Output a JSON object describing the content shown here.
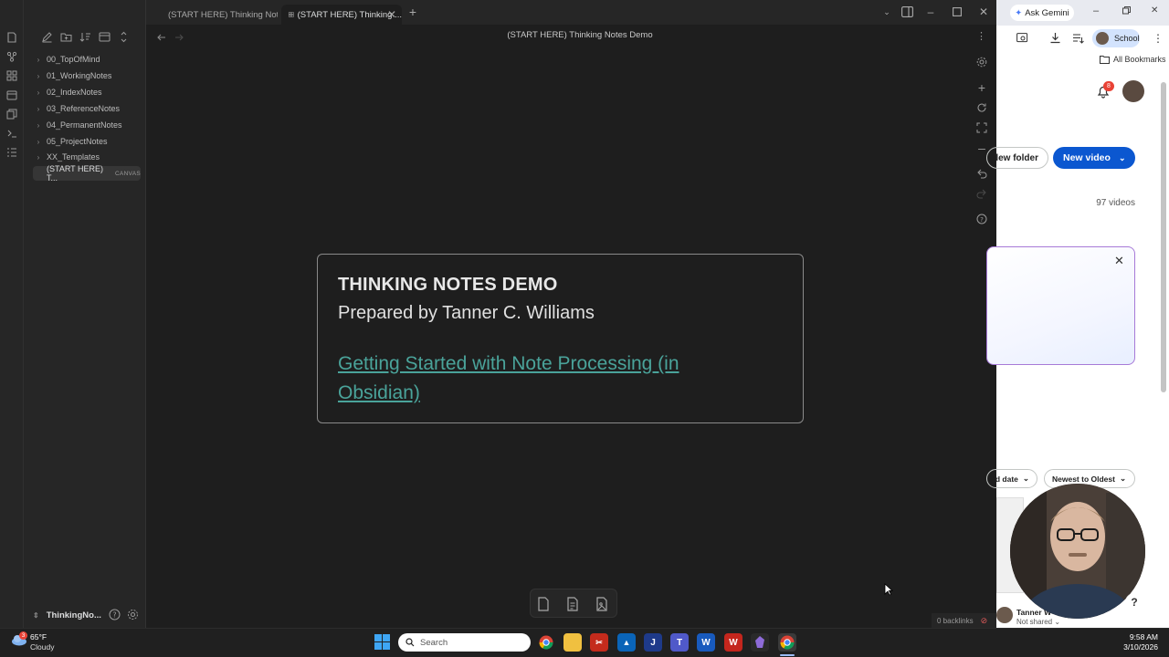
{
  "obsidian": {
    "tabs": [
      {
        "label": "(START HERE) Thinking Not...",
        "active": false
      },
      {
        "label": "(START HERE) Thinking ...",
        "active": true
      }
    ],
    "note_title": "(START HERE) Thinking Notes Demo",
    "folders": [
      {
        "label": "00_TopOfMind"
      },
      {
        "label": "01_WorkingNotes"
      },
      {
        "label": "02_IndexNotes"
      },
      {
        "label": "03_ReferenceNotes"
      },
      {
        "label": "04_PermanentNotes"
      },
      {
        "label": "05_ProjectNotes"
      },
      {
        "label": "XX_Templates"
      }
    ],
    "selected_file": {
      "label": "(START HERE) T...",
      "badge": "CANVAS"
    },
    "vault_name": "ThinkingNo...",
    "card": {
      "heading": "THINKING NOTES DEMO",
      "subheading": "Prepared by Tanner C. Williams",
      "link": "Getting Started with Note Processing (in Obsidian)"
    },
    "backlinks": "0 backlinks",
    "accent_link_color": "#4aa39a"
  },
  "chrome": {
    "ask_gemini": "Ask Gemini",
    "profile_label": "School",
    "all_bookmarks": "All Bookmarks",
    "notification_count": "8",
    "new_folder": "New folder",
    "new_folder_visible": "lew folder",
    "new_video": "New video",
    "video_count": "97 videos",
    "sort_date": "d date",
    "sort_order": "Newest to Oldest",
    "owner": "Tanner W",
    "sharing": "Not shared",
    "help": "?",
    "brand_color": "#0b57d0"
  },
  "taskbar": {
    "weather_temp": "65°F",
    "weather_desc": "Cloudy",
    "weather_badge": "3",
    "search_placeholder": "Search",
    "time": "9:58 AM",
    "date": "3/10/2026"
  }
}
